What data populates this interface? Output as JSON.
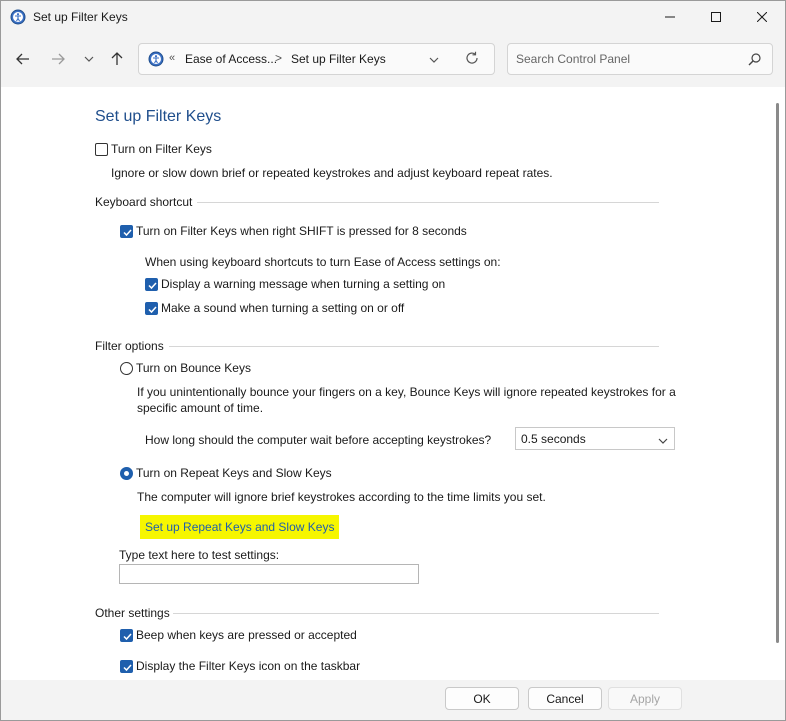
{
  "window": {
    "title": "Set up Filter Keys"
  },
  "nav": {
    "breadcrumb_prefix": "«",
    "crumb1": "Ease of Access...",
    "crumb_sep": ">",
    "crumb2": "Set up Filter Keys",
    "search_placeholder": "Search Control Panel"
  },
  "page": {
    "heading": "Set up Filter Keys",
    "turn_on_filter_keys": {
      "label": "Turn on Filter Keys",
      "checked": false
    },
    "description": "Ignore or slow down brief or repeated keystrokes and adjust keyboard repeat rates.",
    "keyboard_shortcut": {
      "label": "Keyboard shortcut",
      "shift_option": {
        "label": "Turn on Filter Keys when right SHIFT is pressed for 8 seconds",
        "checked": true
      },
      "sub_label": "When using keyboard shortcuts to turn Ease of Access settings on:",
      "warning": {
        "label": "Display a warning message when turning a setting on",
        "checked": true
      },
      "sound": {
        "label": "Make a sound when turning a setting on or off",
        "checked": true
      }
    },
    "filter_options": {
      "label": "Filter options",
      "bounce": {
        "label": "Turn on Bounce Keys",
        "selected": false
      },
      "bounce_desc_1": "If you unintentionally bounce your fingers on a key, Bounce Keys will ignore repeated keystrokes for a",
      "bounce_desc_2": "specific amount of time.",
      "wait_label": "How long should the computer wait before accepting keystrokes?",
      "wait_value": "0.5 seconds",
      "repeat": {
        "label": "Turn on Repeat Keys and Slow Keys",
        "selected": true
      },
      "repeat_desc": "The computer will ignore brief keystrokes according to the time limits you set.",
      "repeat_link": "Set up Repeat Keys and Slow Keys",
      "test_label": "Type text here to test settings:",
      "test_value": ""
    },
    "other_settings": {
      "label": "Other settings",
      "beep": {
        "label": "Beep when keys are pressed or accepted",
        "checked": true
      },
      "taskbar_icon": {
        "label": "Display the Filter Keys icon on the taskbar",
        "checked": true
      }
    }
  },
  "footer": {
    "ok": "OK",
    "cancel": "Cancel",
    "apply": "Apply"
  },
  "colors": {
    "accent": "#1f5fad",
    "heading": "#1f4e8c",
    "highlight": "#f6f600"
  }
}
